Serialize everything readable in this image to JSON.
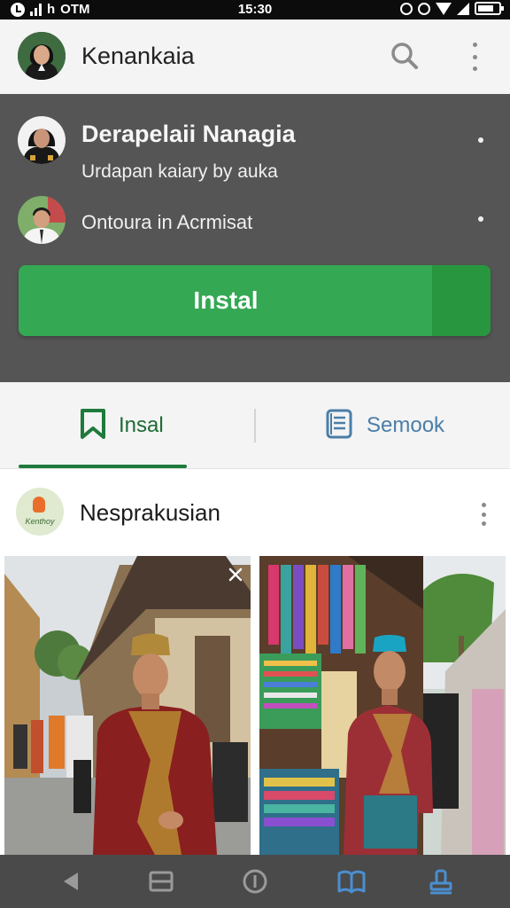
{
  "status_bar": {
    "carrier": "OTM",
    "time": "15:30"
  },
  "app_bar": {
    "title": "Kenankaia",
    "icons": [
      "avatar",
      "search-icon",
      "more-vert-icon"
    ]
  },
  "info_card": {
    "row1": {
      "title": "Derapelaii Nanagia",
      "subtitle": "Urdapan kaiary by auka"
    },
    "row2": {
      "title": "Ontoura in Acrmisat"
    },
    "install_button": {
      "label": "Instal"
    },
    "colors": {
      "card_background": "#555555",
      "button": "#34a853",
      "button_split": "#27963f"
    }
  },
  "tabs": [
    {
      "label": "Insal",
      "icon": "bookmark-icon",
      "selected": true
    },
    {
      "label": "Semook",
      "icon": "document-icon",
      "selected": false
    }
  ],
  "post": {
    "title": "Nesprakusian",
    "logo_text": "Kenthoy",
    "photos": [
      {
        "icon": "close-icon",
        "subject": "man-in-batik-street"
      },
      {
        "subject": "man-in-batik-fabric-shop"
      }
    ]
  },
  "bottom_nav": {
    "items": [
      {
        "icon": "back-icon"
      },
      {
        "icon": "menu-icon"
      },
      {
        "icon": "info-icon"
      },
      {
        "icon": "book-icon",
        "selected": true
      },
      {
        "icon": "stamp-icon"
      }
    ]
  }
}
